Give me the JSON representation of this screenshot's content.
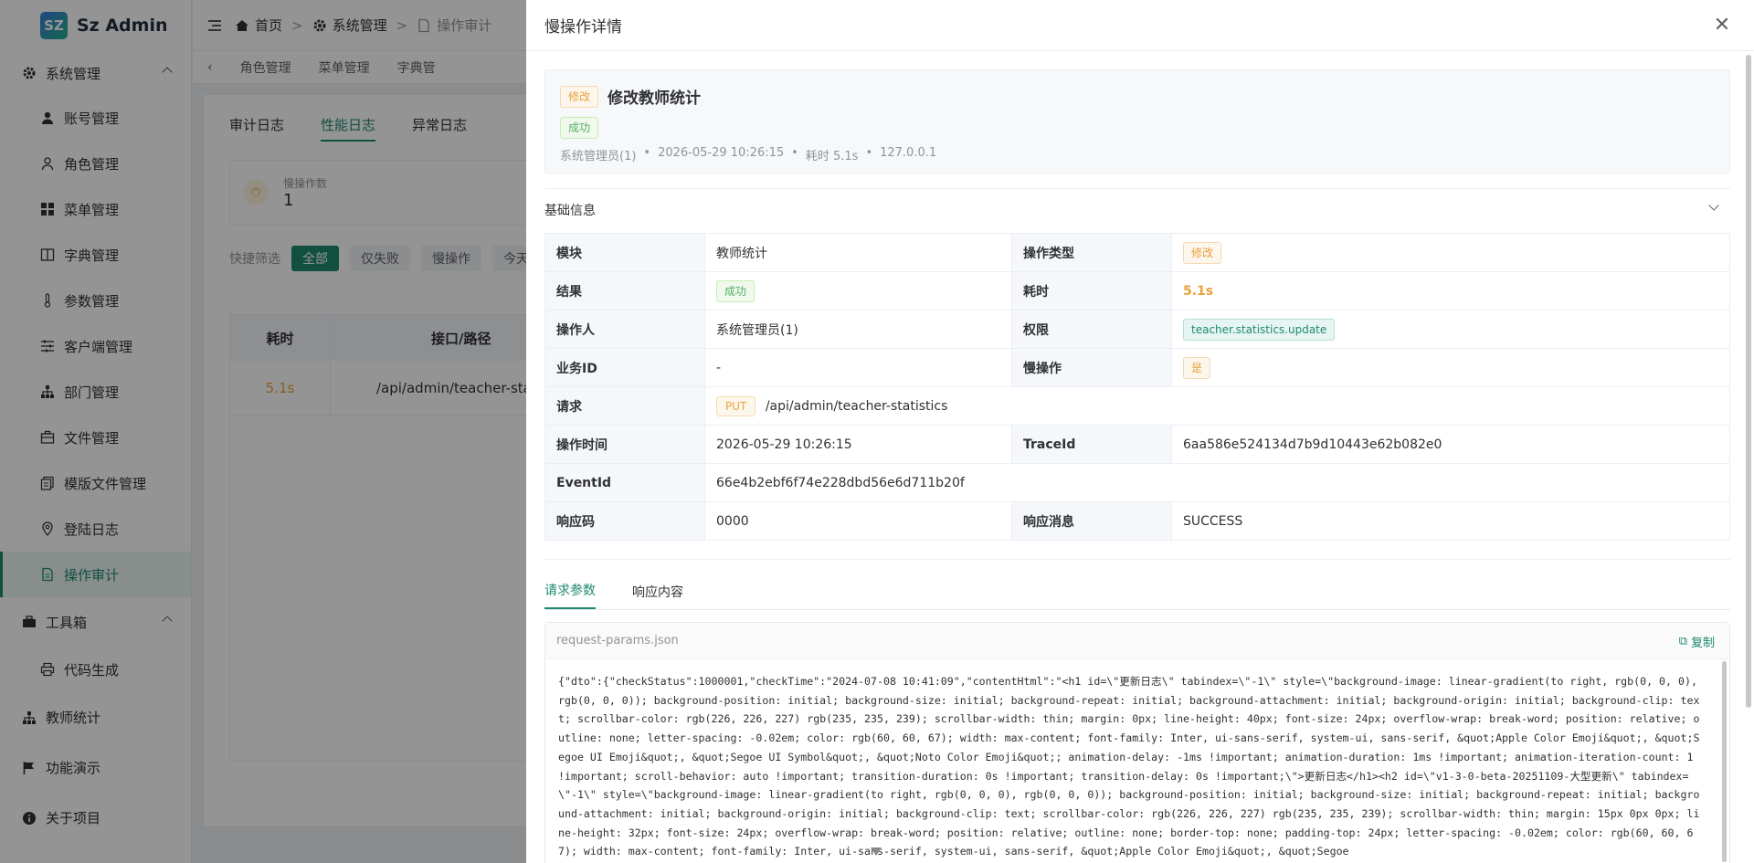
{
  "app": {
    "name": "Sz Admin",
    "logo": "SZ"
  },
  "sidebar": {
    "groups": [
      {
        "label": "系统管理",
        "icon": "gear-icon"
      },
      {
        "label": "工具箱",
        "icon": "toolbox-icon"
      }
    ],
    "system_items": [
      {
        "label": "账号管理",
        "icon": "user-icon"
      },
      {
        "label": "角色管理",
        "icon": "user-outline-icon"
      },
      {
        "label": "菜单管理",
        "icon": "grid-icon"
      },
      {
        "label": "字典管理",
        "icon": "book-icon"
      },
      {
        "label": "参数管理",
        "icon": "thermometer-icon"
      },
      {
        "label": "客户端管理",
        "icon": "sliders-icon"
      },
      {
        "label": "部门管理",
        "icon": "org-icon"
      },
      {
        "label": "文件管理",
        "icon": "briefcase-icon"
      },
      {
        "label": "模版文件管理",
        "icon": "files-icon"
      },
      {
        "label": "登陆日志",
        "icon": "location-icon"
      },
      {
        "label": "操作审计",
        "icon": "document-icon"
      }
    ],
    "tool_items": [
      {
        "label": "代码生成",
        "icon": "printer-icon"
      }
    ],
    "bottom_items": [
      {
        "label": "教师统计",
        "icon": "org-icon"
      },
      {
        "label": "功能演示",
        "icon": "flag-icon"
      },
      {
        "label": "关于项目",
        "icon": "info-icon"
      }
    ]
  },
  "breadcrumb": {
    "home": "首页",
    "system": "系统管理",
    "current": "操作审计"
  },
  "tagsbar": {
    "items": [
      "角色管理",
      "菜单管理",
      "字典管"
    ]
  },
  "bg": {
    "tabs": [
      "审计日志",
      "性能日志",
      "异常日志"
    ],
    "stat_label": "慢操作数",
    "stat_value": "1",
    "quick_label": "快捷筛选",
    "chips": [
      "全部",
      "仅失败",
      "慢操作",
      "今天"
    ],
    "table_headers": [
      "耗时",
      "接口/路径"
    ],
    "table_row": [
      "5.1s",
      "/api/admin/teacher-statist"
    ]
  },
  "drawer": {
    "title": "慢操作详情",
    "summary": {
      "type_tag": "修改",
      "title": "修改教师统计",
      "status_tag": "成功",
      "operator": "系统管理员(1)",
      "time": "2026-05-29 10:26:15",
      "cost": "耗时 5.1s",
      "ip": "127.0.0.1",
      "dot": "•"
    },
    "section_title": "基础信息",
    "fields": {
      "module_label": "模块",
      "module": "教师统计",
      "optype_label": "操作类型",
      "optype": "修改",
      "result_label": "结果",
      "result": "成功",
      "cost_label": "耗时",
      "cost": "5.1s",
      "operator_label": "操作人",
      "operator": "系统管理员(1)",
      "perm_label": "权限",
      "perm": "teacher.statistics.update",
      "bizid_label": "业务ID",
      "bizid": "-",
      "slow_label": "慢操作",
      "slow": "是",
      "request_label": "请求",
      "method": "PUT",
      "path": "/api/admin/teacher-statistics",
      "optime_label": "操作时间",
      "optime": "2026-05-29 10:26:15",
      "traceid_label": "TraceId",
      "traceid": "6aa586e524134d7b9d10443e62b082e0",
      "eventid_label": "EventId",
      "eventid": "66e4b2ebf6f74e228dbd56e6d711b20f",
      "code_label": "响应码",
      "code": "0000",
      "msg_label": "响应消息",
      "msg": "SUCCESS"
    },
    "tabs": [
      "请求参数",
      "响应内容"
    ],
    "code_file": "request-params.json",
    "copy_label": "复制",
    "code": "{\"dto\":{\"checkStatus\":1000001,\"checkTime\":\"2024-07-08 10:41:09\",\"contentHtml\":\"<h1 id=\\\"更新日志\\\" tabindex=\\\"-1\\\" style=\\\"background-image: linear-gradient(to right, rgb(0, 0, 0), rgb(0, 0, 0)); background-position: initial; background-size: initial; background-repeat: initial; background-attachment: initial; background-origin: initial; background-clip: text; scrollbar-color: rgb(226, 226, 227) rgb(235, 235, 239); scrollbar-width: thin; margin: 0px; line-height: 40px; font-size: 24px; overflow-wrap: break-word; position: relative; outline: none; letter-spacing: -0.02em; color: rgb(60, 60, 67); width: max-content; font-family: Inter, ui-sans-serif, system-ui, sans-serif, &quot;Apple Color Emoji&quot;, &quot;Segoe UI Emoji&quot;, &quot;Segoe UI Symbol&quot;, &quot;Noto Color Emoji&quot;; animation-delay: -1ms !important; animation-duration: 1ms !important; animation-iteration-count: 1 !important; scroll-behavior: auto !important; transition-duration: 0s !important; transition-delay: 0s !important;\\\">更新日志</h1><h2 id=\\\"v1-3-0-beta-20251109-大型更新\\\" tabindex=\\\"-1\\\" style=\\\"background-image: linear-gradient(to right, rgb(0, 0, 0), rgb(0, 0, 0)); background-position: initial; background-size: initial; background-repeat: initial; background-attachment: initial; background-origin: initial; background-clip: text; scrollbar-color: rgb(226, 226, 227) rgb(235, 235, 239); scrollbar-width: thin; margin: 15px 0px 0px; line-height: 32px; font-size: 24px; overflow-wrap: break-word; position: relative; outline: none; border-top: none; padding-top: 24px; letter-spacing: -0.02em; color: rgb(60, 60, 67); width: max-content; font-family: Inter, ui-sans-serif, system-ui, sans-serif, &quot;Apple Color Emoji&quot;, &quot;Segoe"
  },
  "colors": {
    "accent": "#1e8a6f",
    "warning": "#e6a23c",
    "success": "#52b06a"
  }
}
